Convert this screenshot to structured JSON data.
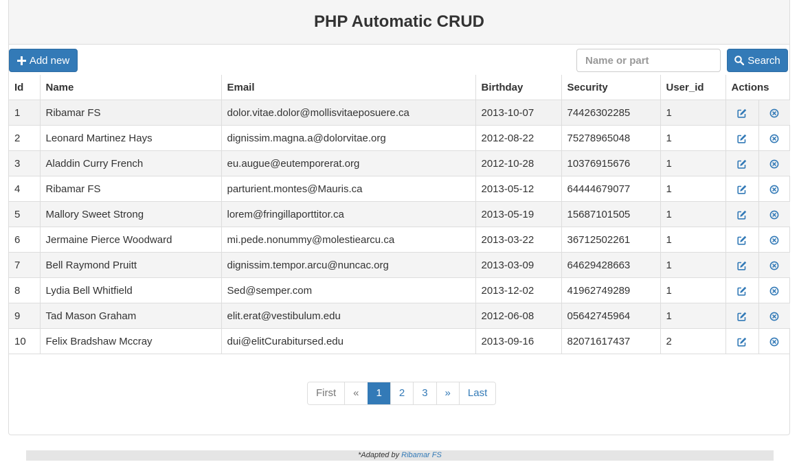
{
  "header": {
    "title": "PHP Automatic CRUD"
  },
  "toolbar": {
    "add_label": "Add new",
    "search_placeholder": "Name or part",
    "search_value": "",
    "search_label": "Search"
  },
  "table": {
    "columns": [
      "Id",
      "Name",
      "Email",
      "Birthday",
      "Security",
      "User_id",
      "Actions"
    ],
    "rows": [
      [
        "1",
        "Ribamar FS",
        "dolor.vitae.dolor@mollisvitaeposuere.ca",
        "2013-10-07",
        "74426302285",
        "1"
      ],
      [
        "2",
        "Leonard Martinez Hays",
        "dignissim.magna.a@dolorvitae.org",
        "2012-08-22",
        "75278965048",
        "1"
      ],
      [
        "3",
        "Aladdin Curry French",
        "eu.augue@eutemporerat.org",
        "2012-10-28",
        "10376915676",
        "1"
      ],
      [
        "4",
        "Ribamar FS",
        "parturient.montes@Mauris.ca",
        "2013-05-12",
        "64444679077",
        "1"
      ],
      [
        "5",
        "Mallory Sweet Strong",
        "lorem@fringillaporttitor.ca",
        "2013-05-19",
        "15687101505",
        "1"
      ],
      [
        "6",
        "Jermaine Pierce Woodward",
        "mi.pede.nonummy@molestiearcu.ca",
        "2013-03-22",
        "36712502261",
        "1"
      ],
      [
        "7",
        "Bell Raymond Pruitt",
        "dignissim.tempor.arcu@nuncac.org",
        "2013-03-09",
        "64629428663",
        "1"
      ],
      [
        "8",
        "Lydia Bell Whitfield",
        "Sed@semper.com",
        "2013-12-02",
        "41962749289",
        "1"
      ],
      [
        "9",
        "Tad Mason Graham",
        "elit.erat@vestibulum.edu",
        "2012-06-08",
        "05642745964",
        "1"
      ],
      [
        "10",
        "Felix Bradshaw Mccray",
        "dui@elitCurabitursed.edu",
        "2013-09-16",
        "82071617437",
        "2"
      ]
    ],
    "row_actions": {
      "edit_icon": "edit-icon",
      "delete_icon": "delete-icon"
    }
  },
  "pagination": {
    "first": "First",
    "prev": "«",
    "pages": [
      "1",
      "2",
      "3"
    ],
    "current": "1",
    "next": "»",
    "last": "Last"
  },
  "footer": {
    "text": "*Adapted by ",
    "link": "Ribamar FS"
  },
  "colors": {
    "primary": "#337ab7",
    "border": "#dddddd",
    "stripe": "#f4f4f4"
  }
}
